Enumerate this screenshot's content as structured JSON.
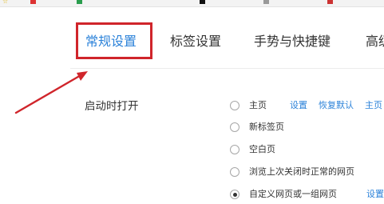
{
  "bookmark_bar": {
    "items": [
      {
        "label": "☆",
        "color": "#e0b000"
      },
      {
        "label": "",
        "color": "#d33"
      },
      {
        "label": "",
        "color": "#2a9d4e"
      },
      {
        "label": "",
        "color": "#111"
      },
      {
        "label": "",
        "color": "#999"
      },
      {
        "label": "",
        "color": "#c33"
      }
    ]
  },
  "tabs": [
    {
      "label": "常规设置",
      "active": true
    },
    {
      "label": "标签设置",
      "active": false
    },
    {
      "label": "手势与快捷键",
      "active": false
    },
    {
      "label": "高级",
      "active": false
    }
  ],
  "startup": {
    "section_label": "启动时打开",
    "options": [
      {
        "label": "主页",
        "checked": false,
        "links": [
          "设置",
          "恢复默认",
          "主页"
        ]
      },
      {
        "label": "新标签页",
        "checked": false,
        "links": []
      },
      {
        "label": "空白页",
        "checked": false,
        "links": []
      },
      {
        "label": "浏览上次关闭时正常的网页",
        "checked": false,
        "links": []
      },
      {
        "label": "自定义网页或一组网页",
        "checked": true,
        "links": [
          "设置"
        ]
      }
    ]
  },
  "colors": {
    "accent": "#2b82d9",
    "annotation": "#d0252b"
  }
}
